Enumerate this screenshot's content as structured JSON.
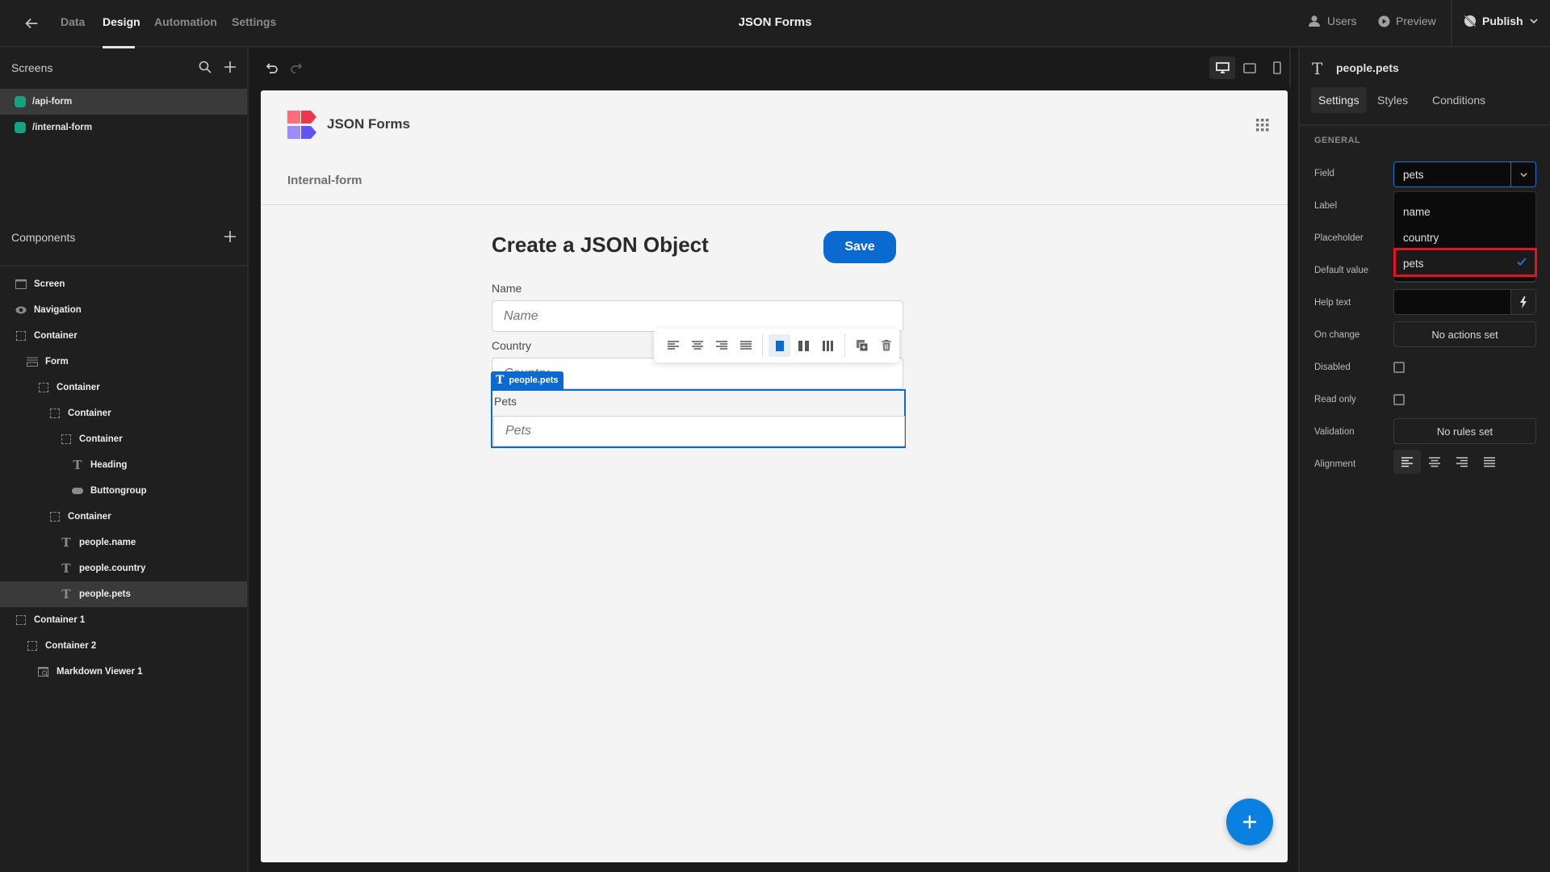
{
  "topbar": {
    "title": "JSON Forms",
    "tabs": [
      {
        "label": "Data",
        "active": false
      },
      {
        "label": "Design",
        "active": true
      },
      {
        "label": "Automation",
        "active": false
      },
      {
        "label": "Settings",
        "active": false
      }
    ],
    "users_label": "Users",
    "preview_label": "Preview",
    "publish_label": "Publish"
  },
  "screens": {
    "title": "Screens",
    "items": [
      {
        "label": "/api-form",
        "selected": true,
        "color": "#14a37f"
      },
      {
        "label": "/internal-form",
        "selected": false,
        "color": "#14a37f"
      }
    ]
  },
  "components": {
    "title": "Components",
    "items": [
      {
        "label": "Screen",
        "icon": "screen-icon",
        "depth": 0,
        "selected": false
      },
      {
        "label": "Navigation",
        "icon": "eye-icon",
        "depth": 0,
        "selected": false
      },
      {
        "label": "Container",
        "icon": "container-icon",
        "depth": 0,
        "selected": false
      },
      {
        "label": "Form",
        "icon": "form-icon",
        "depth": 1,
        "selected": false
      },
      {
        "label": "Container",
        "icon": "container-icon",
        "depth": 2,
        "selected": false
      },
      {
        "label": "Container",
        "icon": "container-icon",
        "depth": 3,
        "selected": false
      },
      {
        "label": "Container",
        "icon": "container-icon",
        "depth": 4,
        "selected": false
      },
      {
        "label": "Heading",
        "icon": "heading-icon",
        "depth": 5,
        "selected": false
      },
      {
        "label": "Buttongroup",
        "icon": "buttongroup-icon",
        "depth": 5,
        "selected": false
      },
      {
        "label": "Container",
        "icon": "container-icon",
        "depth": 3,
        "selected": false
      },
      {
        "label": "people.name",
        "icon": "text-field-icon",
        "depth": 4,
        "selected": false
      },
      {
        "label": "people.country",
        "icon": "text-field-icon",
        "depth": 4,
        "selected": false
      },
      {
        "label": "people.pets",
        "icon": "text-field-icon",
        "depth": 4,
        "selected": true
      },
      {
        "label": "Container 1",
        "icon": "container-icon",
        "depth": 0,
        "selected": false
      },
      {
        "label": "Container 2",
        "icon": "container-icon",
        "depth": 1,
        "selected": false
      },
      {
        "label": "Markdown Viewer 1",
        "icon": "markdown-icon",
        "depth": 2,
        "selected": false
      }
    ]
  },
  "canvas": {
    "brand": "JSON Forms",
    "nav_link": "Internal-form",
    "form_title": "Create a JSON Object",
    "save_label": "Save",
    "fields": [
      {
        "label": "Name",
        "placeholder": "Name"
      },
      {
        "label": "Country",
        "placeholder": "Country"
      },
      {
        "label": "Pets",
        "placeholder": "Pets"
      }
    ],
    "selected_tag": "people.pets",
    "brand_colors": {
      "primary": "#0a6ad0",
      "fab": "#0a80e0"
    }
  },
  "settings": {
    "component_name": "people.pets",
    "tabs": [
      {
        "label": "Settings",
        "active": true
      },
      {
        "label": "Styles",
        "active": false
      },
      {
        "label": "Conditions",
        "active": false
      }
    ],
    "section": "GENERAL",
    "labels": {
      "field": "Field",
      "label": "Label",
      "placeholder": "Placeholder",
      "default_value": "Default value",
      "help_text": "Help text",
      "on_change": "On change",
      "disabled": "Disabled",
      "read_only": "Read only",
      "validation": "Validation",
      "alignment": "Alignment"
    },
    "field_value": "pets",
    "field_options": [
      {
        "label": "name",
        "selected": false
      },
      {
        "label": "country",
        "selected": false
      },
      {
        "label": "pets",
        "selected": true
      }
    ],
    "help_text_value": "",
    "on_change_value": "No actions set",
    "disabled_checked": false,
    "read_only_checked": false,
    "validation_value": "No rules set",
    "alignment_selected": "left"
  }
}
